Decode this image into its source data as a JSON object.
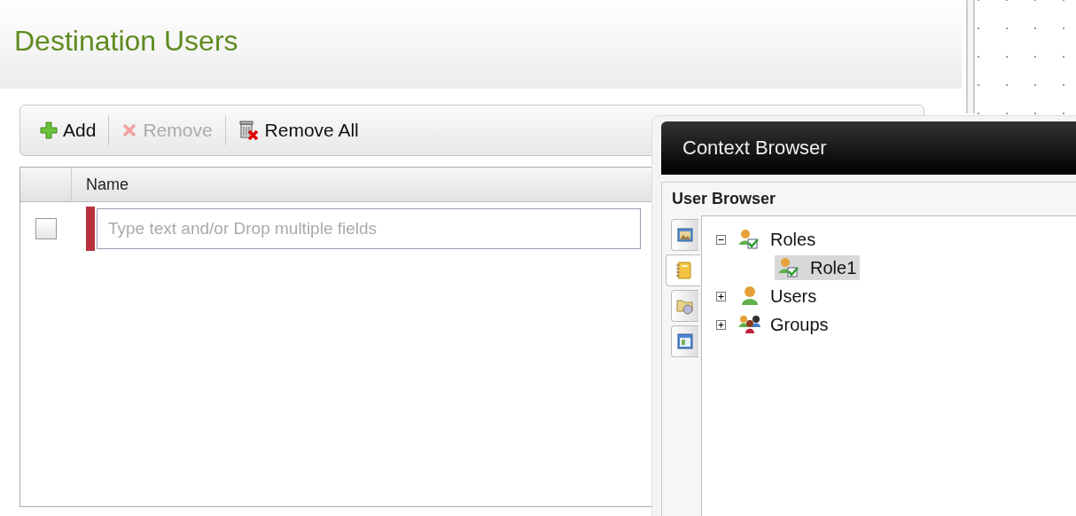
{
  "page": {
    "title": "Destination Users"
  },
  "toolbar": [
    {
      "kind": "add",
      "label": "Add",
      "disabled": false
    },
    {
      "kind": "remove",
      "label": "Remove",
      "disabled": true
    },
    {
      "kind": "remove_all",
      "label": "Remove All",
      "disabled": false
    }
  ],
  "grid": {
    "columns": [
      "Name"
    ],
    "rows": [
      {
        "checked": false,
        "placeholder": "Type text and/or Drop multiple fields"
      }
    ]
  },
  "context_browser": {
    "title": "Context Browser",
    "section": "User Browser",
    "side_tabs": [
      {
        "kind": "image",
        "selected": false
      },
      {
        "kind": "notebook",
        "selected": true
      },
      {
        "kind": "folder",
        "selected": false
      },
      {
        "kind": "form",
        "selected": false
      }
    ],
    "tree": [
      {
        "label": "Roles",
        "kind": "role",
        "expanded": true,
        "selected": false,
        "children": [
          {
            "label": "Role1",
            "kind": "role",
            "selected": true
          }
        ]
      },
      {
        "label": "Users",
        "kind": "user",
        "expanded": false,
        "selected": false
      },
      {
        "label": "Groups",
        "kind": "group",
        "expanded": false,
        "selected": false
      }
    ]
  }
}
